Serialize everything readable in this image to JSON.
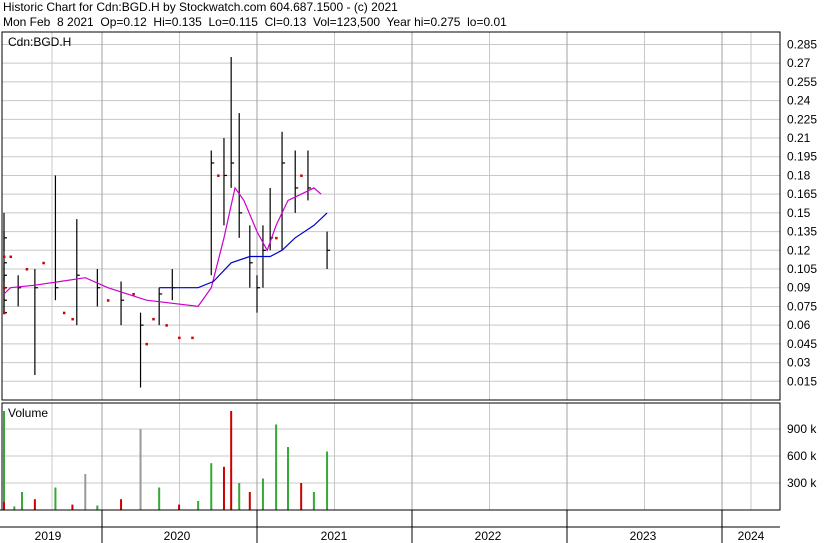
{
  "header": {
    "line1": "Historic Chart for Cdn:BGD.H by Stockwatch.com 604.687.1500 - (c) 2021",
    "line2": "Mon Feb  8 2021  Op=0.12  Hi=0.135  Lo=0.115  Cl=0.13  Vol=123,500  Year hi=0.275  lo=0.01"
  },
  "colors": {
    "price_bar": "#000000",
    "unchanged_tick": "#cc0000",
    "ma_short": "#cc00cc",
    "ma_long": "#0000cc",
    "volume_up": "#33aa33",
    "volume_down": "#cc0000",
    "volume_flat": "#999999",
    "grid": "#c8c8c8"
  },
  "chart_data": [
    {
      "type": "ohlc",
      "title": "Cdn:BGD.H",
      "x_tick_labels": [
        "2019",
        "2020",
        "2021",
        "2022",
        "2023",
        "2024"
      ],
      "y_tick_labels": [
        "0.285",
        "0.27",
        "0.255",
        "0.24",
        "0.225",
        "0.21",
        "0.195",
        "0.18",
        "0.165",
        "0.15",
        "0.135",
        "0.12",
        "0.105",
        "0.09",
        "0.075",
        "0.06",
        "0.045",
        "0.03",
        "0.015"
      ],
      "ylim": [
        0.0,
        0.295
      ],
      "grid": true,
      "series": [
        {
          "kind": "price",
          "points": [
            {
              "date": "2018-06-01",
              "hi": 0.15,
              "lo": 0.12,
              "cl": 0.13
            },
            {
              "date": "2018-07-01",
              "hi": 0.1,
              "lo": 0.08,
              "cl": 0.09
            },
            {
              "date": "2018-08-01",
              "hi": 0.08,
              "lo": 0.07,
              "cl": 0.07
            },
            {
              "date": "2018-09-15",
              "hi": 0.085,
              "lo": 0.07,
              "cl": 0.08
            },
            {
              "date": "2018-11-15",
              "hi": 0.135,
              "lo": 0.095,
              "cl": 0.11
            },
            {
              "date": "2019-01-01",
              "hi": 0.11,
              "lo": 0.085,
              "cl": 0.1
            },
            {
              "date": "2019-03-01",
              "hi": 0.1,
              "lo": 0.075,
              "cl": 0.09
            },
            {
              "date": "2019-05-01",
              "hi": 0.105,
              "lo": 0.02,
              "cl": 0.09
            },
            {
              "date": "2019-07-15",
              "hi": 0.18,
              "lo": 0.08,
              "cl": 0.09
            },
            {
              "date": "2019-10-01",
              "hi": 0.145,
              "lo": 0.06,
              "cl": 0.1
            },
            {
              "date": "2019-12-15",
              "hi": 0.105,
              "lo": 0.075,
              "cl": 0.09
            },
            {
              "date": "2020-02-15",
              "hi": 0.095,
              "lo": 0.06,
              "cl": 0.08
            },
            {
              "date": "2020-04-01",
              "hi": 0.07,
              "lo": 0.01,
              "cl": 0.06
            },
            {
              "date": "2020-05-15",
              "hi": 0.09,
              "lo": 0.06,
              "cl": 0.085
            },
            {
              "date": "2020-06-15",
              "hi": 0.105,
              "lo": 0.08,
              "cl": 0.09
            },
            {
              "date": "2020-09-15",
              "hi": 0.2,
              "lo": 0.1,
              "cl": 0.19
            },
            {
              "date": "2020-10-15",
              "hi": 0.21,
              "lo": 0.14,
              "cl": 0.18
            },
            {
              "date": "2020-11-01",
              "hi": 0.275,
              "lo": 0.17,
              "cl": 0.19
            },
            {
              "date": "2020-11-20",
              "hi": 0.23,
              "lo": 0.13,
              "cl": 0.15
            },
            {
              "date": "2020-12-15",
              "hi": 0.14,
              "lo": 0.09,
              "cl": 0.11
            },
            {
              "date": "2021-01-01",
              "hi": 0.1,
              "lo": 0.07,
              "cl": 0.09
            },
            {
              "date": "2021-01-15",
              "hi": 0.14,
              "lo": 0.09,
              "cl": 0.12
            },
            {
              "date": "2021-02-01",
              "hi": 0.17,
              "lo": 0.12,
              "cl": 0.13
            },
            {
              "date": "2021-03-01",
              "hi": 0.215,
              "lo": 0.12,
              "cl": 0.19
            },
            {
              "date": "2021-04-01",
              "hi": 0.2,
              "lo": 0.15,
              "cl": 0.17
            },
            {
              "date": "2021-05-01",
              "hi": 0.2,
              "lo": 0.16,
              "cl": 0.17
            },
            {
              "date": "2021-06-15",
              "hi": 0.135,
              "lo": 0.105,
              "cl": 0.12
            }
          ],
          "unchanged_ticks": [
            {
              "date": "2018-06-20",
              "value": 0.09
            },
            {
              "date": "2018-08-20",
              "value": 0.07
            },
            {
              "date": "2018-10-15",
              "value": 0.07
            },
            {
              "date": "2018-12-15",
              "value": 0.115
            },
            {
              "date": "2019-02-01",
              "value": 0.115
            },
            {
              "date": "2019-04-01",
              "value": 0.105
            },
            {
              "date": "2019-06-01",
              "value": 0.11
            },
            {
              "date": "2019-08-15",
              "value": 0.07
            },
            {
              "date": "2019-09-15",
              "value": 0.065
            },
            {
              "date": "2020-01-15",
              "value": 0.08
            },
            {
              "date": "2020-03-15",
              "value": 0.085
            },
            {
              "date": "2020-04-15",
              "value": 0.045
            },
            {
              "date": "2020-05-01",
              "value": 0.065
            },
            {
              "date": "2020-06-01",
              "value": 0.06
            },
            {
              "date": "2020-07-01",
              "value": 0.05
            },
            {
              "date": "2020-08-01",
              "value": 0.05
            },
            {
              "date": "2020-10-01",
              "value": 0.18
            },
            {
              "date": "2021-02-15",
              "value": 0.13
            },
            {
              "date": "2021-04-15",
              "value": 0.18
            }
          ]
        },
        {
          "kind": "moving_average_short",
          "points": [
            {
              "date": "2018-11-15",
              "value": 0.085
            },
            {
              "date": "2019-02-01",
              "value": 0.09
            },
            {
              "date": "2019-05-01",
              "value": 0.092
            },
            {
              "date": "2019-08-01",
              "value": 0.095
            },
            {
              "date": "2019-11-01",
              "value": 0.098
            },
            {
              "date": "2020-01-15",
              "value": 0.09
            },
            {
              "date": "2020-04-15",
              "value": 0.08
            },
            {
              "date": "2020-08-15",
              "value": 0.075
            },
            {
              "date": "2020-09-15",
              "value": 0.09
            },
            {
              "date": "2020-10-15",
              "value": 0.13
            },
            {
              "date": "2020-11-10",
              "value": 0.17
            },
            {
              "date": "2020-12-01",
              "value": 0.16
            },
            {
              "date": "2021-01-01",
              "value": 0.135
            },
            {
              "date": "2021-01-25",
              "value": 0.12
            },
            {
              "date": "2021-02-15",
              "value": 0.14
            },
            {
              "date": "2021-03-15",
              "value": 0.16
            },
            {
              "date": "2021-04-15",
              "value": 0.165
            },
            {
              "date": "2021-05-15",
              "value": 0.17
            },
            {
              "date": "2021-06-01",
              "value": 0.165
            }
          ]
        },
        {
          "kind": "moving_average_long",
          "points": [
            {
              "date": "2020-05-15",
              "value": 0.09
            },
            {
              "date": "2020-08-15",
              "value": 0.09
            },
            {
              "date": "2020-09-20",
              "value": 0.095
            },
            {
              "date": "2020-11-01",
              "value": 0.11
            },
            {
              "date": "2020-12-15",
              "value": 0.115
            },
            {
              "date": "2021-02-01",
              "value": 0.115
            },
            {
              "date": "2021-03-01",
              "value": 0.12
            },
            {
              "date": "2021-04-01",
              "value": 0.13
            },
            {
              "date": "2021-05-15",
              "value": 0.14
            },
            {
              "date": "2021-06-15",
              "value": 0.15
            }
          ]
        }
      ]
    },
    {
      "type": "bar",
      "title": "Volume",
      "y_tick_labels": [
        "900 k",
        "600 k",
        "300 k"
      ],
      "ylim": [
        0,
        1100000
      ],
      "bars": [
        {
          "date": "2018-06-10",
          "value": 280000,
          "dir": "down"
        },
        {
          "date": "2018-07-01",
          "value": 120000,
          "dir": "up"
        },
        {
          "date": "2018-08-01",
          "value": 60000,
          "dir": "down"
        },
        {
          "date": "2018-09-15",
          "value": 40000,
          "dir": "up"
        },
        {
          "date": "2018-10-15",
          "value": 1100000,
          "dir": "up"
        },
        {
          "date": "2018-11-15",
          "value": 180000,
          "dir": "up"
        },
        {
          "date": "2019-01-01",
          "value": 90000,
          "dir": "down"
        },
        {
          "date": "2019-02-15",
          "value": 40000,
          "dir": "up"
        },
        {
          "date": "2019-03-15",
          "value": 200000,
          "dir": "up"
        },
        {
          "date": "2019-05-01",
          "value": 120000,
          "dir": "down"
        },
        {
          "date": "2019-07-15",
          "value": 250000,
          "dir": "up"
        },
        {
          "date": "2019-09-15",
          "value": 60000,
          "dir": "down"
        },
        {
          "date": "2019-11-01",
          "value": 400000,
          "dir": "flat"
        },
        {
          "date": "2019-12-15",
          "value": 50000,
          "dir": "up"
        },
        {
          "date": "2020-02-15",
          "value": 120000,
          "dir": "down"
        },
        {
          "date": "2020-04-01",
          "value": 900000,
          "dir": "flat"
        },
        {
          "date": "2020-05-15",
          "value": 250000,
          "dir": "up"
        },
        {
          "date": "2020-07-01",
          "value": 60000,
          "dir": "down"
        },
        {
          "date": "2020-08-15",
          "value": 100000,
          "dir": "up"
        },
        {
          "date": "2020-09-15",
          "value": 520000,
          "dir": "up"
        },
        {
          "date": "2020-10-15",
          "value": 480000,
          "dir": "down"
        },
        {
          "date": "2020-11-01",
          "value": 1100000,
          "dir": "down"
        },
        {
          "date": "2020-11-20",
          "value": 300000,
          "dir": "up"
        },
        {
          "date": "2020-12-15",
          "value": 200000,
          "dir": "down"
        },
        {
          "date": "2021-01-15",
          "value": 350000,
          "dir": "up"
        },
        {
          "date": "2021-02-15",
          "value": 950000,
          "dir": "up"
        },
        {
          "date": "2021-03-15",
          "value": 700000,
          "dir": "up"
        },
        {
          "date": "2021-04-15",
          "value": 300000,
          "dir": "down"
        },
        {
          "date": "2021-05-15",
          "value": 200000,
          "dir": "up"
        },
        {
          "date": "2021-06-15",
          "value": 650000,
          "dir": "up"
        }
      ]
    }
  ]
}
